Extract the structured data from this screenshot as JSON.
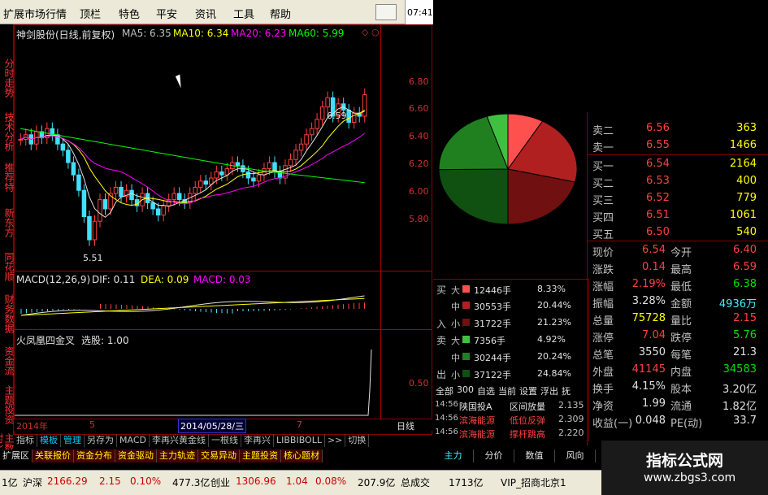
{
  "menu": {
    "items": [
      "扩展市场行情",
      "顶栏",
      "特色",
      "平安",
      "资讯",
      "工具",
      "帮助"
    ],
    "time": "07:41"
  },
  "left_tabs": [
    "分时走势",
    "技术分析",
    "推荐特",
    "新东方",
    "同花顺",
    "财务数据",
    "资金流",
    "主题投资",
    "主数对比"
  ],
  "chart": {
    "title": "神剑股份(日线,前复权)",
    "ma": [
      {
        "label": "MA5: 6.35",
        "color": "#e0e0e0"
      },
      {
        "label": "MA10: 6.34",
        "color": "#ffff00"
      },
      {
        "label": "MA20: 6.23",
        "color": "#ff00ff"
      },
      {
        "label": "MA60: 5.99",
        "color": "#00ff00"
      }
    ],
    "price_axis": [
      "6.80",
      "6.60",
      "6.40",
      "6.20",
      "6.00",
      "5.80"
    ],
    "high_label": "6.59",
    "low_label": "5.51",
    "macd_header": {
      "name": "MACD(12,26,9)",
      "dif": "DIF: 0.11",
      "dea": "DEA: 0.09",
      "macd": "MACD: 0.03"
    },
    "indicator_header": {
      "name": "火凤凰四金叉",
      "value": "选股: 1.00"
    },
    "indicator_axis": "0.50",
    "date_bar": {
      "year": "2014年",
      "m5": "5",
      "date": "2014/05/28/三",
      "m7": "7",
      "period": "日线"
    },
    "price_range": [
      5.4,
      6.9
    ]
  },
  "bottom_tabs_1": [
    "指标",
    "模板",
    "管理",
    "另存为",
    "MACD",
    "李再兴黄金线",
    "一根线",
    "李再兴",
    "LIBBIBOLL",
    ">>",
    "切换"
  ],
  "bottom_tabs_2": [
    "扩展区",
    "关联报价",
    "资金分布",
    "资金驱动",
    "主力轨迹",
    "交易异动",
    "主题投资",
    "核心题材"
  ],
  "right_tabs": [
    "主力",
    "分价",
    "数值",
    "风向"
  ],
  "pie": {
    "slices": [
      {
        "label": "买大",
        "value": 8.33,
        "color": "#ff5050"
      },
      {
        "label": "买中",
        "value": 20.44,
        "color": "#b02020"
      },
      {
        "label": "买小",
        "value": 21.23,
        "color": "#701010"
      },
      {
        "label": "卖小",
        "value": 24.84,
        "color": "#105010"
      },
      {
        "label": "卖中",
        "value": 20.24,
        "color": "#208020"
      },
      {
        "label": "卖大",
        "value": 4.92,
        "color": "#40c040"
      }
    ]
  },
  "flow": {
    "buy_label": [
      "买",
      "入"
    ],
    "sell_label": [
      "卖",
      "出"
    ],
    "rows": [
      {
        "side": "大",
        "vol": "12446手",
        "pct": "8.33%",
        "color": "#ff5050"
      },
      {
        "side": "中",
        "vol": "30553手",
        "pct": "20.44%",
        "color": "#b02020"
      },
      {
        "side": "小",
        "vol": "31722手",
        "pct": "21.23%",
        "color": "#701010"
      },
      {
        "side": "大",
        "vol": "7356手",
        "pct": "4.92%",
        "color": "#40c040"
      },
      {
        "side": "中",
        "vol": "30244手",
        "pct": "20.24%",
        "color": "#208020"
      },
      {
        "side": "小",
        "vol": "37122手",
        "pct": "24.84%",
        "color": "#105010"
      }
    ],
    "filters": [
      "全部",
      "300",
      "自选",
      "当前",
      "设置",
      "浮出",
      "抚"
    ]
  },
  "news": [
    {
      "time": "14:56",
      "name": "陕国投A",
      "event": "区间放量",
      "val": "2.135"
    },
    {
      "time": "14:56",
      "name": "滨海能源",
      "event": "低位反弹",
      "val": "2.309"
    },
    {
      "time": "14:56",
      "name": "滨海能源",
      "event": "撑杆跳高",
      "val": "2.220"
    }
  ],
  "orderbook": {
    "sell": [
      {
        "label": "卖二",
        "price": "6.56",
        "vol": "363"
      },
      {
        "label": "卖一",
        "price": "6.55",
        "vol": "1466"
      }
    ],
    "buy": [
      {
        "label": "买一",
        "price": "6.54",
        "vol": "2164"
      },
      {
        "label": "买二",
        "price": "6.53",
        "vol": "400"
      },
      {
        "label": "买三",
        "price": "6.52",
        "vol": "779"
      },
      {
        "label": "买四",
        "price": "6.51",
        "vol": "1061"
      },
      {
        "label": "买五",
        "price": "6.50",
        "vol": "540"
      }
    ]
  },
  "stats": [
    {
      "l1": "现价",
      "v1": "6.54",
      "c1": "red",
      "l2": "今开",
      "v2": "6.40",
      "c2": "red"
    },
    {
      "l1": "涨跌",
      "v1": "0.14",
      "c1": "red",
      "l2": "最高",
      "v2": "6.59",
      "c2": "red"
    },
    {
      "l1": "涨幅",
      "v1": "2.19%",
      "c1": "red",
      "l2": "最低",
      "v2": "6.38",
      "c2": "green"
    },
    {
      "l1": "振幅",
      "v1": "3.28%",
      "c1": "white",
      "l2": "金额",
      "v2": "4936万",
      "c2": "cyan"
    },
    {
      "l1": "总量",
      "v1": "75728",
      "c1": "yellow",
      "l2": "量比",
      "v2": "2.15",
      "c2": "red"
    },
    {
      "l1": "涨停",
      "v1": "7.04",
      "c1": "red",
      "l2": "跌停",
      "v2": "5.76",
      "c2": "green"
    },
    {
      "l1": "总笔",
      "v1": "3550",
      "c1": "white",
      "l2": "每笔",
      "v2": "21.3",
      "c2": "white"
    },
    {
      "l1": "外盘",
      "v1": "41145",
      "c1": "red",
      "l2": "内盘",
      "v2": "34583",
      "c2": "green"
    },
    {
      "l1": "换手",
      "v1": "4.15%",
      "c1": "white",
      "l2": "股本",
      "v2": "3.20亿",
      "c2": "white"
    },
    {
      "l1": "净资",
      "v1": "1.99",
      "c1": "white",
      "l2": "流通",
      "v2": "1.82亿",
      "c2": "white"
    },
    {
      "l1": "收益(一)",
      "v1": "0.048",
      "c1": "white",
      "l2": "PE(动)",
      "v2": "33.7",
      "c2": "white"
    }
  ],
  "status": {
    "s0": "1亿",
    "sh_label": "沪深",
    "sh_val": "2166.29",
    "sh_chg": "2.15",
    "sh_pct": "0.10%",
    "sh_amt": "477.3亿",
    "cy_label": "创业",
    "cy_val": "1306.96",
    "cy_chg": "1.04",
    "cy_pct": "0.08%",
    "cy_amt": "207.9亿",
    "total_label": "总成交",
    "total_val": "1713亿",
    "broker": "VIP_招商北京1"
  },
  "watermark": {
    "title": "指标公式网",
    "url": "www.zbgs3.com"
  }
}
